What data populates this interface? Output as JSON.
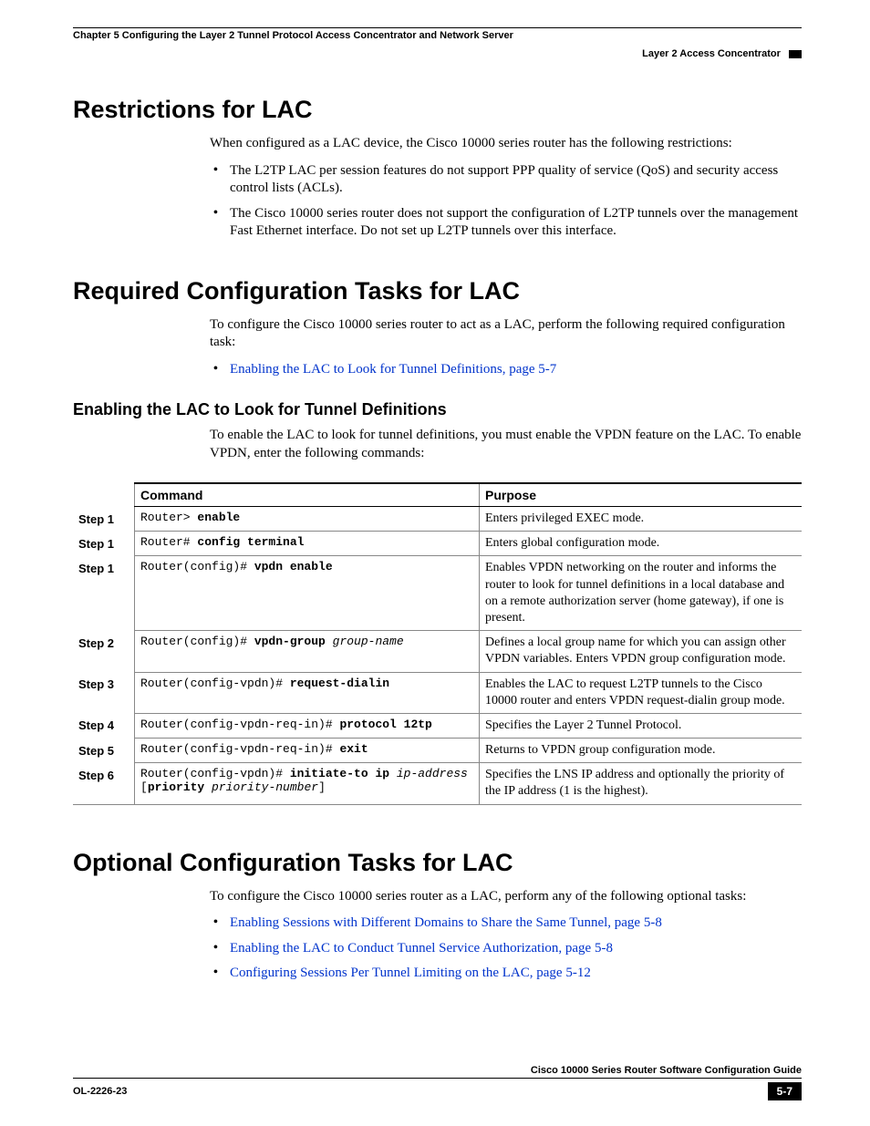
{
  "header": {
    "chapter": "Chapter 5      Configuring the Layer 2 Tunnel Protocol Access Concentrator and Network Server",
    "section": "Layer 2 Access Concentrator"
  },
  "s1": {
    "title": "Restrictions for LAC",
    "intro": "When configured as a LAC device, the Cisco 10000 series router has the following restrictions:",
    "b1": "The L2TP LAC per session features do not support PPP quality of service (QoS) and security access control lists (ACLs).",
    "b2": "The Cisco 10000 series router does not support the configuration of L2TP tunnels over the management Fast Ethernet interface. Do not set up L2TP tunnels over this interface."
  },
  "s2": {
    "title": "Required Configuration Tasks for LAC",
    "intro": "To configure the Cisco 10000 series router to act as a LAC, perform the following required configuration task:",
    "link1": "Enabling the LAC to Look for Tunnel Definitions, page 5-7",
    "sub_title": "Enabling the LAC to Look for Tunnel Definitions",
    "sub_intro": "To enable the LAC to look for tunnel definitions, you must enable the VPDN feature on the LAC. To enable VPDN, enter the following commands:"
  },
  "table": {
    "h_cmd": "Command",
    "h_purpose": "Purpose",
    "r1": {
      "step": "Step 1",
      "prompt": "Router> ",
      "cmd": "enable",
      "purpose": "Enters privileged EXEC mode."
    },
    "r2": {
      "step": "Step 1",
      "prompt": "Router# ",
      "cmd": "config terminal",
      "purpose": "Enters global configuration mode."
    },
    "r3": {
      "step": "Step 1",
      "prompt": "Router(config)# ",
      "cmd": "vpdn enable",
      "purpose": "Enables VPDN networking on the router and informs the router to look for tunnel definitions in a local database and on a remote authorization server (home gateway), if one is present."
    },
    "r4": {
      "step": "Step 2",
      "prompt": "Router(config)# ",
      "cmd": "vpdn-group",
      "arg": " group-name",
      "purpose": "Defines a local group name for which you can assign other VPDN variables. Enters VPDN group configuration mode."
    },
    "r5": {
      "step": "Step 3",
      "prompt": "Router(config-vpdn)# ",
      "cmd": "request-dialin",
      "purpose": "Enables the LAC to request L2TP tunnels to the Cisco 10000 router and enters VPDN request-dialin group mode."
    },
    "r6": {
      "step": "Step 4",
      "prompt": "Router(config-vpdn-req-in)# ",
      "cmd": "protocol 12tp",
      "purpose": "Specifies the Layer 2 Tunnel Protocol."
    },
    "r7": {
      "step": "Step 5",
      "prompt": "Router(config-vpdn-req-in)# ",
      "cmd": "exit",
      "purpose": "Returns to VPDN group configuration mode."
    },
    "r8": {
      "step": "Step 6",
      "prompt": "Router(config-vpdn)# ",
      "cmd": "initiate-to ip",
      "arg": " ip-address",
      "line2a": "[",
      "line2b": "priority",
      "line2c": " priority-number",
      "line2d": "]",
      "purpose": "Specifies the LNS IP address and optionally the priority of the IP address (1 is the highest)."
    }
  },
  "s3": {
    "title": "Optional Configuration Tasks for LAC",
    "intro": "To configure the Cisco 10000 series router as a LAC, perform any of the following optional tasks:",
    "link1": "Enabling Sessions with Different Domains to Share the Same Tunnel, page 5-8",
    "link2": "Enabling the LAC to Conduct Tunnel Service Authorization, page 5-8",
    "link3": "Configuring Sessions Per Tunnel Limiting on the LAC, page 5-12"
  },
  "footer": {
    "title": "Cisco 10000 Series Router Software Configuration Guide",
    "doc": "OL-2226-23",
    "page": "5-7"
  }
}
